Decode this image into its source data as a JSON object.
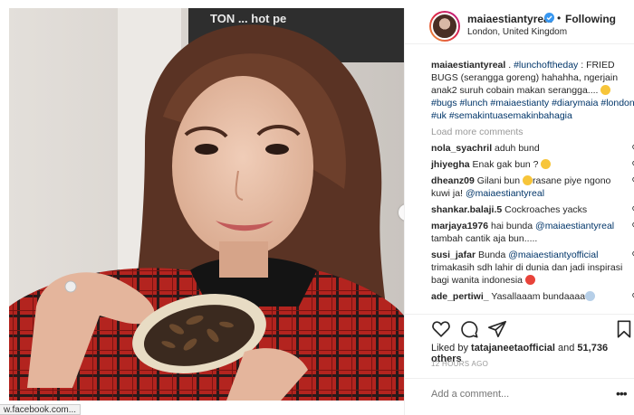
{
  "browser": {
    "status_url": "w.facebook.com..."
  },
  "photo": {
    "icons": [
      "chevron-right-icon"
    ],
    "carousel_pages": 2,
    "carousel_active": 1,
    "sign_text": "TON ... hot pe"
  },
  "post": {
    "username": "maiaestiantyreal",
    "following_label": "Following",
    "separator": "•",
    "location": "London, United Kingdom",
    "caption": {
      "username": "maiaestiantyreal",
      "text_1": " . ",
      "tag_1": "#lunchoftheday",
      "text_2": " : FRIED BUGS (serangga goreng) hahahha, ngerjain anak2 suruh cobain makan serangga.... ",
      "tags": "#bugs #lunch #maiaestianty #diarymaia #london #uk #semakintuasemakinbahagia"
    },
    "load_more": "Load more comments",
    "comments": [
      {
        "user": "nola_syachril",
        "text": " aduh bund",
        "emoji": ""
      },
      {
        "user": "jhiyegha",
        "text": " Enak gak bun ? ",
        "emoji": "grin"
      },
      {
        "user": "dheanz09",
        "text": " Gilani bun ",
        "emoji": "laugh",
        "text2": "rasane piye ngono kuwi ja! ",
        "mention": "@maiaestiantyreal"
      },
      {
        "user": "shankar.balaji.5",
        "text": " Cockroaches yacks",
        "emoji": ""
      },
      {
        "user": "marjaya1976",
        "text": " hai bunda ",
        "mention": "@maiaestiantyreal",
        "text2": " tambah cantik aja bun.....",
        "emoji": ""
      },
      {
        "user": "susi_jafar",
        "text": " Bunda ",
        "mention": "@maiaestiantyofficial",
        "text2": " trimakasih sdh lahir di dunia dan jadi inspirasi bagi wanita indonesia ",
        "emoji": "heart-eyes"
      },
      {
        "user": "ade_pertiwi_",
        "text": " Yasallaaam bundaaaa",
        "emoji": "scream"
      }
    ],
    "likes": {
      "prefix": "Liked by ",
      "user": "tatajaneetaofficial",
      "middle": " and ",
      "count": "51,736 others"
    },
    "time": "12 HOURS AGO",
    "add_comment_placeholder": "Add a comment...",
    "more_label": "•••"
  },
  "colors": {
    "link": "#003569",
    "blue_dot": "#3897f0",
    "verified": "#3897f0"
  }
}
